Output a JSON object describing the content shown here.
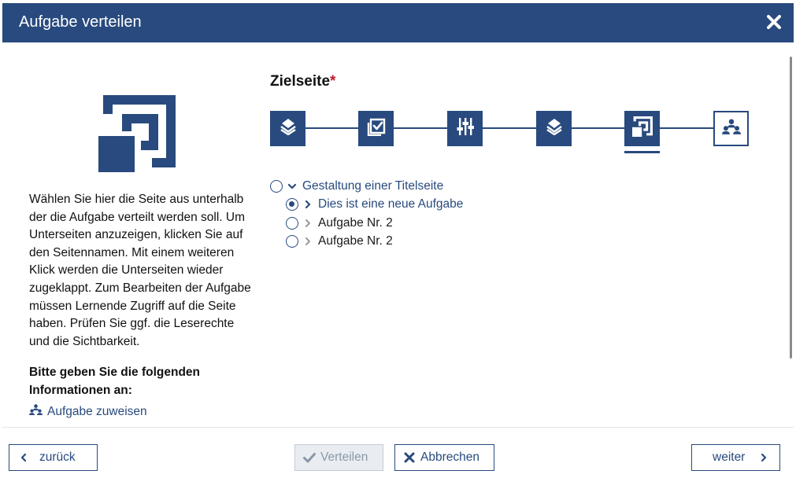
{
  "dialog": {
    "title": "Aufgabe verteilen",
    "close_icon": "close-x-icon"
  },
  "left": {
    "hero_icon": "page-select-icon",
    "help_text": "Wählen Sie hier die Seite aus unterhalb der die Aufgabe verteilt werden soll. Um Unterseiten anzuzeigen, klicken Sie auf den Seitennamen. Mit einem weiteren Klick werden die Unterseiten wieder zugeklappt. Zum Bearbeiten der Aufgabe müssen Lernende Zugriff auf die Seite haben. Prüfen Sie ggf. die Leserechte und die Sichtbarkeit.",
    "info_title": "Bitte geben Sie die folgenden Informationen an:",
    "assign_link": "Aufgabe zuweisen",
    "assign_icon": "users-group-icon"
  },
  "main": {
    "section_title": "Zielseite",
    "required_mark": "*",
    "steps": [
      {
        "icon": "layers-icon",
        "active": false
      },
      {
        "icon": "checkbox-icon",
        "active": false
      },
      {
        "icon": "sliders-icon",
        "active": false
      },
      {
        "icon": "layers-icon",
        "active": false
      },
      {
        "icon": "page-select-icon",
        "active": true
      },
      {
        "icon": "users-group-icon",
        "active": false
      }
    ],
    "tree": [
      {
        "label": "Gestaltung einer Titelseite",
        "level": 0,
        "expanded": true,
        "selected": false
      },
      {
        "label": "Dies ist eine neue Aufgabe",
        "level": 1,
        "expanded": false,
        "selected": true
      },
      {
        "label": "Aufgabe Nr. 2",
        "level": 1,
        "expanded": false,
        "selected": false
      },
      {
        "label": "Aufgabe Nr. 2",
        "level": 1,
        "expanded": false,
        "selected": false
      }
    ]
  },
  "footer": {
    "back_label": "zurück",
    "distribute_label": "Verteilen",
    "cancel_label": "Abbrechen",
    "next_label": "weiter"
  },
  "colors": {
    "primary": "#284a7e",
    "required": "#c0182b",
    "disabled_bg": "#e9edf2"
  }
}
